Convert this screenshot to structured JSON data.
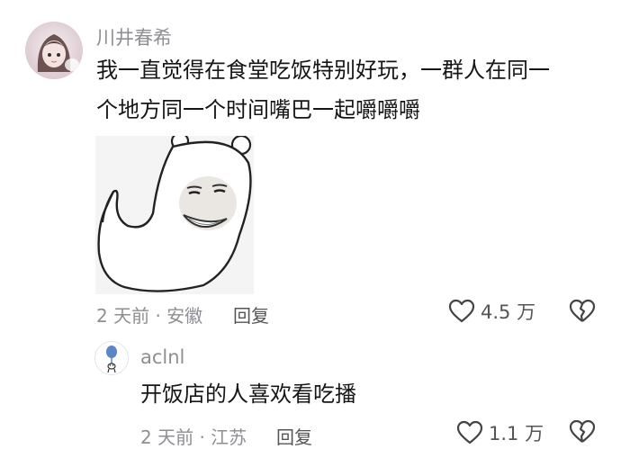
{
  "comments": [
    {
      "username": "川井春希",
      "text_line1": "我一直觉得在食堂吃饭特别好玩，一群人在同一",
      "text_line2": "个地方同一个时间嘴巴一起嚼嚼嚼",
      "sticker": "ghost-meme-sticker",
      "time_location": "2 天前 · 安徽",
      "reply_label": "回复",
      "like_count": "4.5 万",
      "like_icon": "heart-outline-icon",
      "dislike_icon": "broken-heart-icon"
    },
    {
      "username": "aclnl",
      "text": "开饭店的人喜欢看吃播",
      "time_location": "2 天前 · 江苏",
      "reply_label": "回复",
      "like_count": "1.1 万",
      "like_icon": "heart-outline-icon",
      "dislike_icon": "broken-heart-icon"
    }
  ],
  "colors": {
    "meta_text": "#8e8e93",
    "content_text": "#161616",
    "icon_stroke": "#444444"
  }
}
